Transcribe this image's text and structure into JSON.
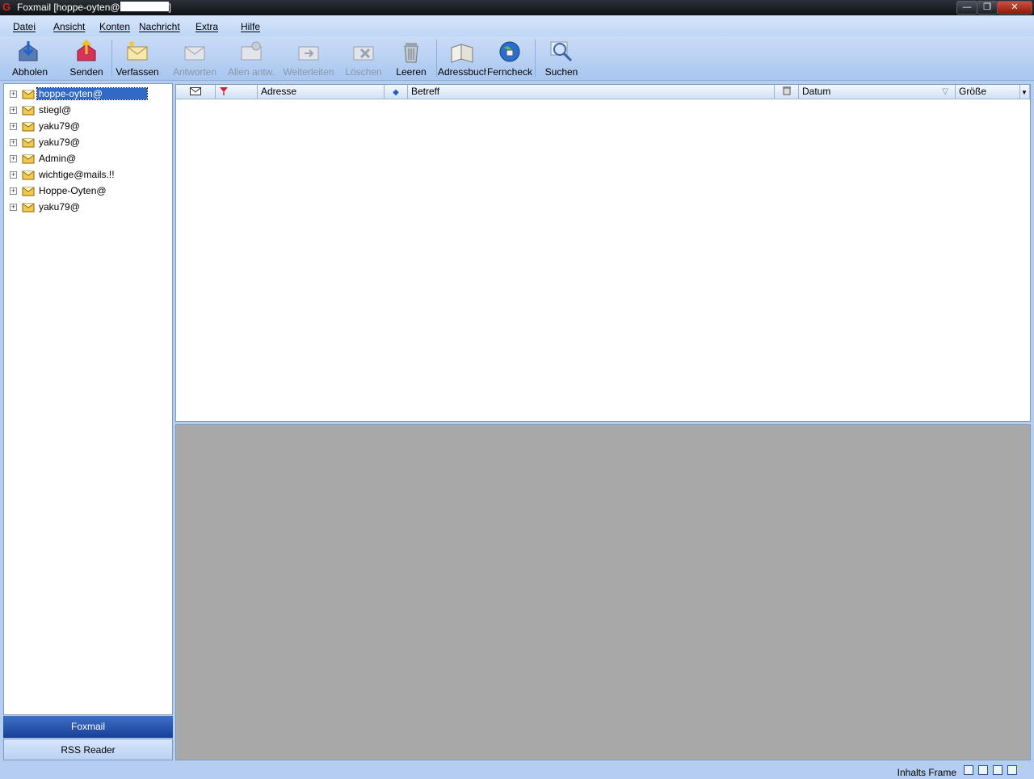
{
  "window": {
    "title": "Foxmail [hoppe-oyten@",
    "minimize_label": "—",
    "maximize_label": "❐",
    "close_label": "✕"
  },
  "menu": {
    "items": [
      "Datei",
      "Ansicht",
      "Konten",
      "Nachricht",
      "Extra",
      "Hilfe"
    ]
  },
  "toolbar": {
    "buttons": [
      {
        "label": "Abholen",
        "icon": "fetch-mail-icon",
        "enabled": true
      },
      {
        "label": "Senden",
        "icon": "send-mail-icon",
        "enabled": true
      },
      {
        "label": "Verfassen",
        "icon": "compose-icon",
        "enabled": true
      },
      {
        "label": "Antworten",
        "icon": "reply-icon",
        "enabled": false
      },
      {
        "label": "Allen antw.",
        "icon": "reply-all-icon",
        "enabled": false
      },
      {
        "label": "Weiterleiten",
        "icon": "forward-icon",
        "enabled": false
      },
      {
        "label": "Löschen",
        "icon": "delete-icon",
        "enabled": false
      },
      {
        "label": "Leeren",
        "icon": "trash-icon",
        "enabled": true
      },
      {
        "label": "Adressbuch",
        "icon": "address-book-icon",
        "enabled": true
      },
      {
        "label": "Ferncheck",
        "icon": "globe-icon",
        "enabled": true
      },
      {
        "label": "Suchen",
        "icon": "search-icon",
        "enabled": true
      }
    ]
  },
  "accounts": [
    {
      "label": "hoppe-oyten@",
      "selected": true
    },
    {
      "label": "stiegl@",
      "selected": false
    },
    {
      "label": "yaku79@",
      "selected": false
    },
    {
      "label": "yaku79@",
      "selected": false
    },
    {
      "label": "Admin@",
      "selected": false
    },
    {
      "label": "wichtige@mails.!!",
      "selected": false
    },
    {
      "label": "Hoppe-Oyten@",
      "selected": false
    },
    {
      "label": "yaku79@",
      "selected": false
    }
  ],
  "nav": {
    "foxmail": "Foxmail",
    "rss": "RSS Reader"
  },
  "columns": {
    "address": "Adresse",
    "subject": "Betreff",
    "date": "Datum",
    "size": "Größe"
  },
  "status": {
    "text": "Inhalts Frame"
  },
  "colors": {
    "accent": "#3169c6",
    "panel_bg": "#b4cdf0",
    "preview_bg": "#a8a8a8"
  }
}
